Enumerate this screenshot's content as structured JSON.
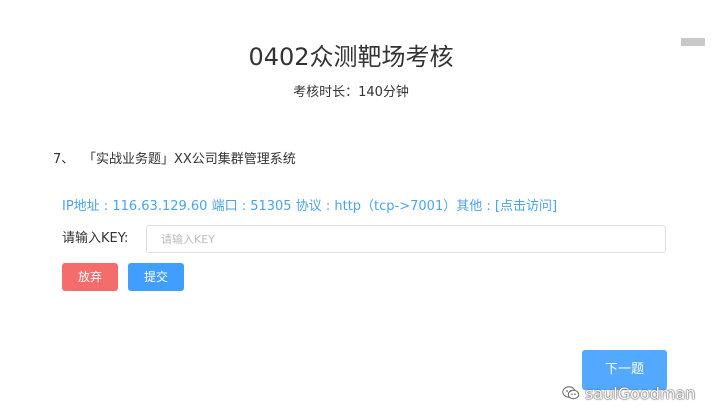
{
  "exam": {
    "title": "0402众测靶场考核",
    "duration_label": "考核时长：",
    "duration_value": "140分钟"
  },
  "question": {
    "number": "7、",
    "text": "「实战业务题」XX公司集群管理系统"
  },
  "target": {
    "ip_label": "IP地址 : ",
    "ip": "116.63.129.60",
    "port_label": " 端口 : ",
    "port": "51305",
    "protocol_label": " 协议 : ",
    "protocol": "http（tcp->7001）",
    "other_label": "其他 : ",
    "access_link": "[点击访问]"
  },
  "key_form": {
    "label": "请输入KEY:",
    "placeholder": "请输入KEY",
    "value": ""
  },
  "buttons": {
    "abandon": "放弃",
    "submit": "提交",
    "next": "下一题"
  },
  "watermark": {
    "text": "saulGoodman",
    "icon": "wechat-icon"
  },
  "colors": {
    "link_blue": "#4ba3f0",
    "submit_blue": "#409eff",
    "next_blue": "#53a8ff",
    "abandon_red": "#f56c6c",
    "input_border": "#dcdfe6"
  }
}
